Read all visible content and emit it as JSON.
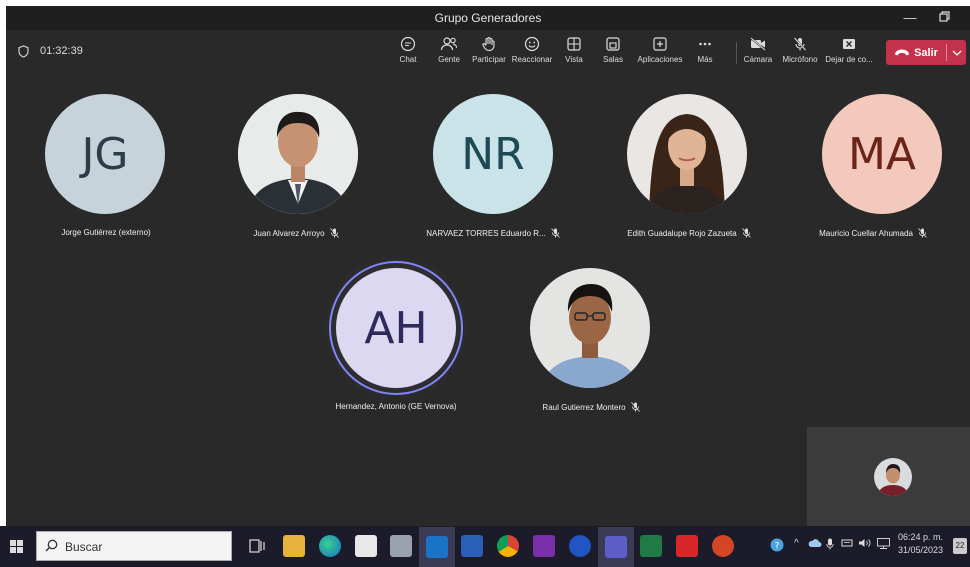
{
  "window": {
    "title": "Grupo Generadores"
  },
  "meeting": {
    "timer": "01:32:39"
  },
  "toolbar": {
    "items": [
      {
        "label": "Chat",
        "icon": "chat-icon"
      },
      {
        "label": "Gente",
        "icon": "people-icon"
      },
      {
        "label": "Participar",
        "icon": "raise-hand-icon"
      },
      {
        "label": "Reaccionar",
        "icon": "reaction-icon"
      },
      {
        "label": "Vista",
        "icon": "view-icon"
      },
      {
        "label": "Salas",
        "icon": "rooms-icon"
      },
      {
        "label": "Aplicaciones",
        "icon": "apps-icon"
      },
      {
        "label": "Más",
        "icon": "more-icon"
      },
      {
        "label": "Cámara",
        "icon": "camera-off-icon"
      },
      {
        "label": "Micrófono",
        "icon": "mic-off-icon"
      },
      {
        "label": "Dejar de co...",
        "icon": "stop-share-icon"
      }
    ],
    "leave_label": "Salir"
  },
  "participants": [
    {
      "name": "Jorge Gutiérrez (externo)",
      "initials": "JG",
      "avatar_bg": "#c7d3da",
      "initials_color": "#2b3d47",
      "muted": false
    },
    {
      "name": "Juan Alvarez Arroyo",
      "initials": "",
      "photo": "man-suit",
      "muted": true
    },
    {
      "name": "NARVAEZ TORRES Eduardo R...",
      "initials": "NR",
      "avatar_bg": "#c9e3e8",
      "initials_color": "#1d4a55",
      "muted": true
    },
    {
      "name": "Edith Guadalupe Rojo Zazueta",
      "initials": "",
      "photo": "woman",
      "muted": true
    },
    {
      "name": "Mauricio Cuellar Ahumada",
      "initials": "MA",
      "avatar_bg": "#f4c9bd",
      "initials_color": "#6a2518",
      "muted": true
    },
    {
      "name": "Hernandez, Antonio (GE Vernova)",
      "initials": "AH",
      "avatar_bg": "#dcd8f2",
      "initials_color": "#2d2a5c",
      "muted": false,
      "speaking": true
    },
    {
      "name": "Raul Gutierrez Montero",
      "initials": "",
      "photo": "man-glasses",
      "muted": true
    }
  ],
  "taskbar": {
    "search_placeholder": "Buscar",
    "clock_time": "06:24 p. m.",
    "clock_date": "31/05/2023",
    "notification_count": "22"
  },
  "colors": {
    "accent": "#7f85f5",
    "leave": "#c4314b",
    "stage": "#292929"
  }
}
